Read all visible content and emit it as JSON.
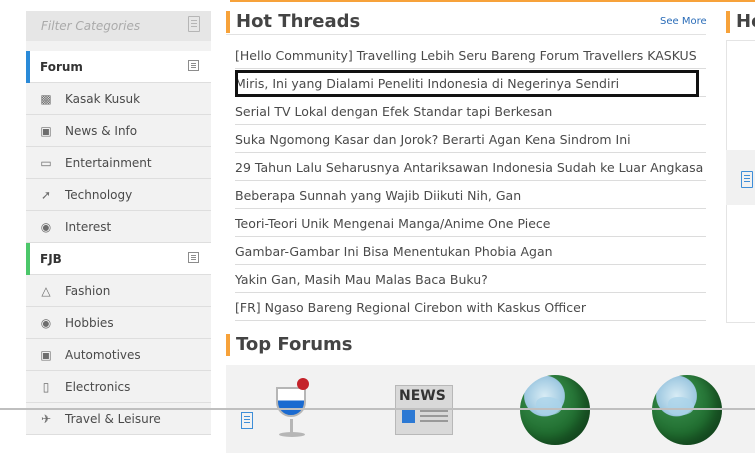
{
  "sidebar": {
    "filter_placeholder": "Filter Categories",
    "sections": [
      {
        "title": "Forum",
        "accent": "#2a8ad8",
        "items": [
          {
            "label": "Kasak Kusuk",
            "icon": "chat-bubbles-icon"
          },
          {
            "label": "News & Info",
            "icon": "briefcase-icon"
          },
          {
            "label": "Entertainment",
            "icon": "tv-icon"
          },
          {
            "label": "Technology",
            "icon": "rocket-icon"
          },
          {
            "label": "Interest",
            "icon": "palette-icon"
          }
        ]
      },
      {
        "title": "FJB",
        "accent": "#4cc76a",
        "items": [
          {
            "label": "Fashion",
            "icon": "hanger-icon"
          },
          {
            "label": "Hobbies",
            "icon": "palette-icon"
          },
          {
            "label": "Automotives",
            "icon": "car-icon"
          },
          {
            "label": "Electronics",
            "icon": "phone-icon"
          },
          {
            "label": "Travel & Leisure",
            "icon": "airplane-icon"
          }
        ]
      }
    ]
  },
  "hot_threads": {
    "title": "Hot Threads",
    "see_more": "See More",
    "items": [
      "[Hello Community] Travelling Lebih Seru Bareng Forum Travellers KASKUS",
      "Miris, Ini yang Dialami Peneliti Indonesia di Negerinya Sendiri",
      "Serial TV Lokal dengan Efek Standar tapi Berkesan",
      "Suka Ngomong Kasar dan Jorok? Berarti Agan Kena Sindrom Ini",
      "29 Tahun Lalu Seharusnya Antariksawan Indonesia Sudah ke Luar Angkasa",
      "Beberapa Sunnah yang Wajib Diikuti Nih, Gan",
      "Teori-Teori Unik Mengenai Manga/Anime One Piece",
      "Gambar-Gambar Ini Bisa Menentukan Phobia Agan",
      "Yakin Gan, Masih Mau Malas Baca Buku?",
      "[FR] Ngaso Bareng Regional Cirebon with Kaskus Officer"
    ]
  },
  "right_panel": {
    "title_partial": "Ho"
  },
  "top_forums": {
    "title": "Top Forums",
    "tiles": [
      {
        "icon": "cocktail-glass-icon"
      },
      {
        "icon": "newspaper-icon",
        "label": "NEWS"
      },
      {
        "icon": "globe-icon"
      },
      {
        "icon": "globe-icon"
      }
    ]
  },
  "colors": {
    "accent_orange": "#f7a23a",
    "link_blue": "#2a6cb8"
  }
}
